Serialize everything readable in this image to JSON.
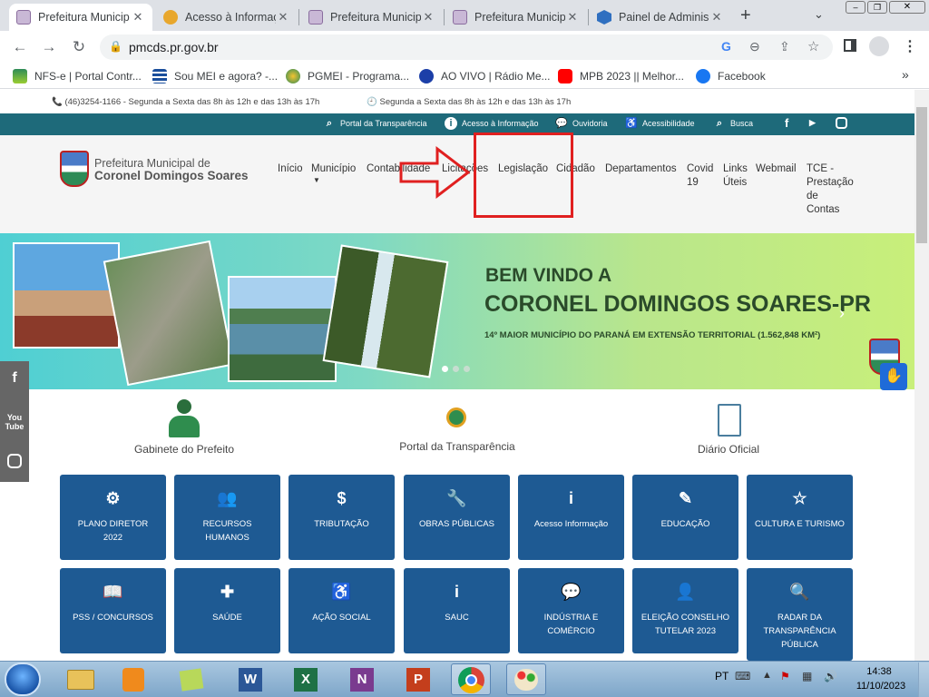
{
  "browser": {
    "tabs": [
      {
        "title": "Prefeitura Municip",
        "active": true
      },
      {
        "title": "Acesso à Informaç",
        "active": false
      },
      {
        "title": "Prefeitura Municip",
        "active": false
      },
      {
        "title": "Prefeitura Municip",
        "active": false
      },
      {
        "title": "Painel de Adminis",
        "active": false
      }
    ],
    "url": "pmcds.pr.gov.br",
    "bookmarks": [
      "NFS-e | Portal Contr...",
      "Sou MEI e agora? -...",
      "PGMEI - Programa...",
      "AO VIVO | Rádio Me...",
      "MPB 2023 || Melhor...",
      "Facebook"
    ],
    "more_bookmarks": "»"
  },
  "site": {
    "info_phone": "(46)3254-1166 - Segunda a Sexta das 8h às 12h e das 13h às 17h",
    "info_hours": "Segunda a Sexta das 8h às 12h e das 13h às 17h",
    "top_links": [
      "Portal da Transparência",
      "Acesso à Informação",
      "Ouvidoria",
      "Acessibilidade",
      "Busca"
    ],
    "logo_line1": "Prefeitura Municipal de",
    "logo_line2": "Coronel Domingos Soares",
    "menu": {
      "inicio": "Início",
      "municipio": "Município",
      "contabilidade": "Contabilidade",
      "licitacoes": "Licitações",
      "legislacao": "Legislação",
      "cidadao": "Cidadão",
      "departamentos": "Departamentos",
      "covid1": "Covid",
      "covid2": "19",
      "links1": "Links",
      "links2": "Úteis",
      "webmail": "Webmail",
      "tce1": "TCE -",
      "tce2": "Prestação",
      "tce3": "de",
      "tce4": "Contas"
    },
    "banner": {
      "line1": "BEM VINDO A",
      "line2": "CORONEL DOMINGOS SOARES-PR",
      "line3": "14º MAIOR MUNICÍPIO DO PARANÁ EM EXTENSÃO TERRITORIAL (1.562,848 KM²)"
    },
    "quick": {
      "gabinete": "Gabinete do Prefeito",
      "transparencia": "Portal da Transparência",
      "diario": "Diário Oficial"
    },
    "cards": [
      {
        "l1": "PLANO DIRETOR",
        "l2": "2022",
        "icon": "⚙"
      },
      {
        "l1": "RECURSOS",
        "l2": "HUMANOS",
        "icon": "👥"
      },
      {
        "l1": "TRIBUTAÇÃO",
        "l2": "",
        "icon": "$"
      },
      {
        "l1": "OBRAS PÚBLICAS",
        "l2": "",
        "icon": "🔧"
      },
      {
        "l1": "Acesso Informação",
        "l2": "",
        "icon": "i"
      },
      {
        "l1": "EDUCAÇÃO",
        "l2": "",
        "icon": "✎"
      },
      {
        "l1": "CULTURA E TURISMO",
        "l2": "",
        "icon": "☆"
      },
      {
        "l1": "PSS / CONCURSOS",
        "l2": "",
        "icon": "📖"
      },
      {
        "l1": "SAÚDE",
        "l2": "",
        "icon": "✚"
      },
      {
        "l1": "AÇÃO SOCIAL",
        "l2": "",
        "icon": "♿"
      },
      {
        "l1": "SAUC",
        "l2": "",
        "icon": "i"
      },
      {
        "l1": "INDÚSTRIA E",
        "l2": "COMÉRCIO",
        "icon": "💬"
      },
      {
        "l1": "ELEIÇÃO CONSELHO",
        "l2": "TUTELAR 2023",
        "icon": "👤"
      },
      {
        "l1": "RADAR DA",
        "l2": "TRANSPARÊNCIA",
        "l3": "PÚBLICA",
        "icon": "🔍"
      }
    ]
  },
  "taskbar": {
    "lang": "PT",
    "time": "14:38",
    "date": "11/10/2023"
  },
  "colors": {
    "teal_bar": "#1e6a7a",
    "card_blue": "#1e5a93",
    "highlight_red": "#e02020"
  }
}
